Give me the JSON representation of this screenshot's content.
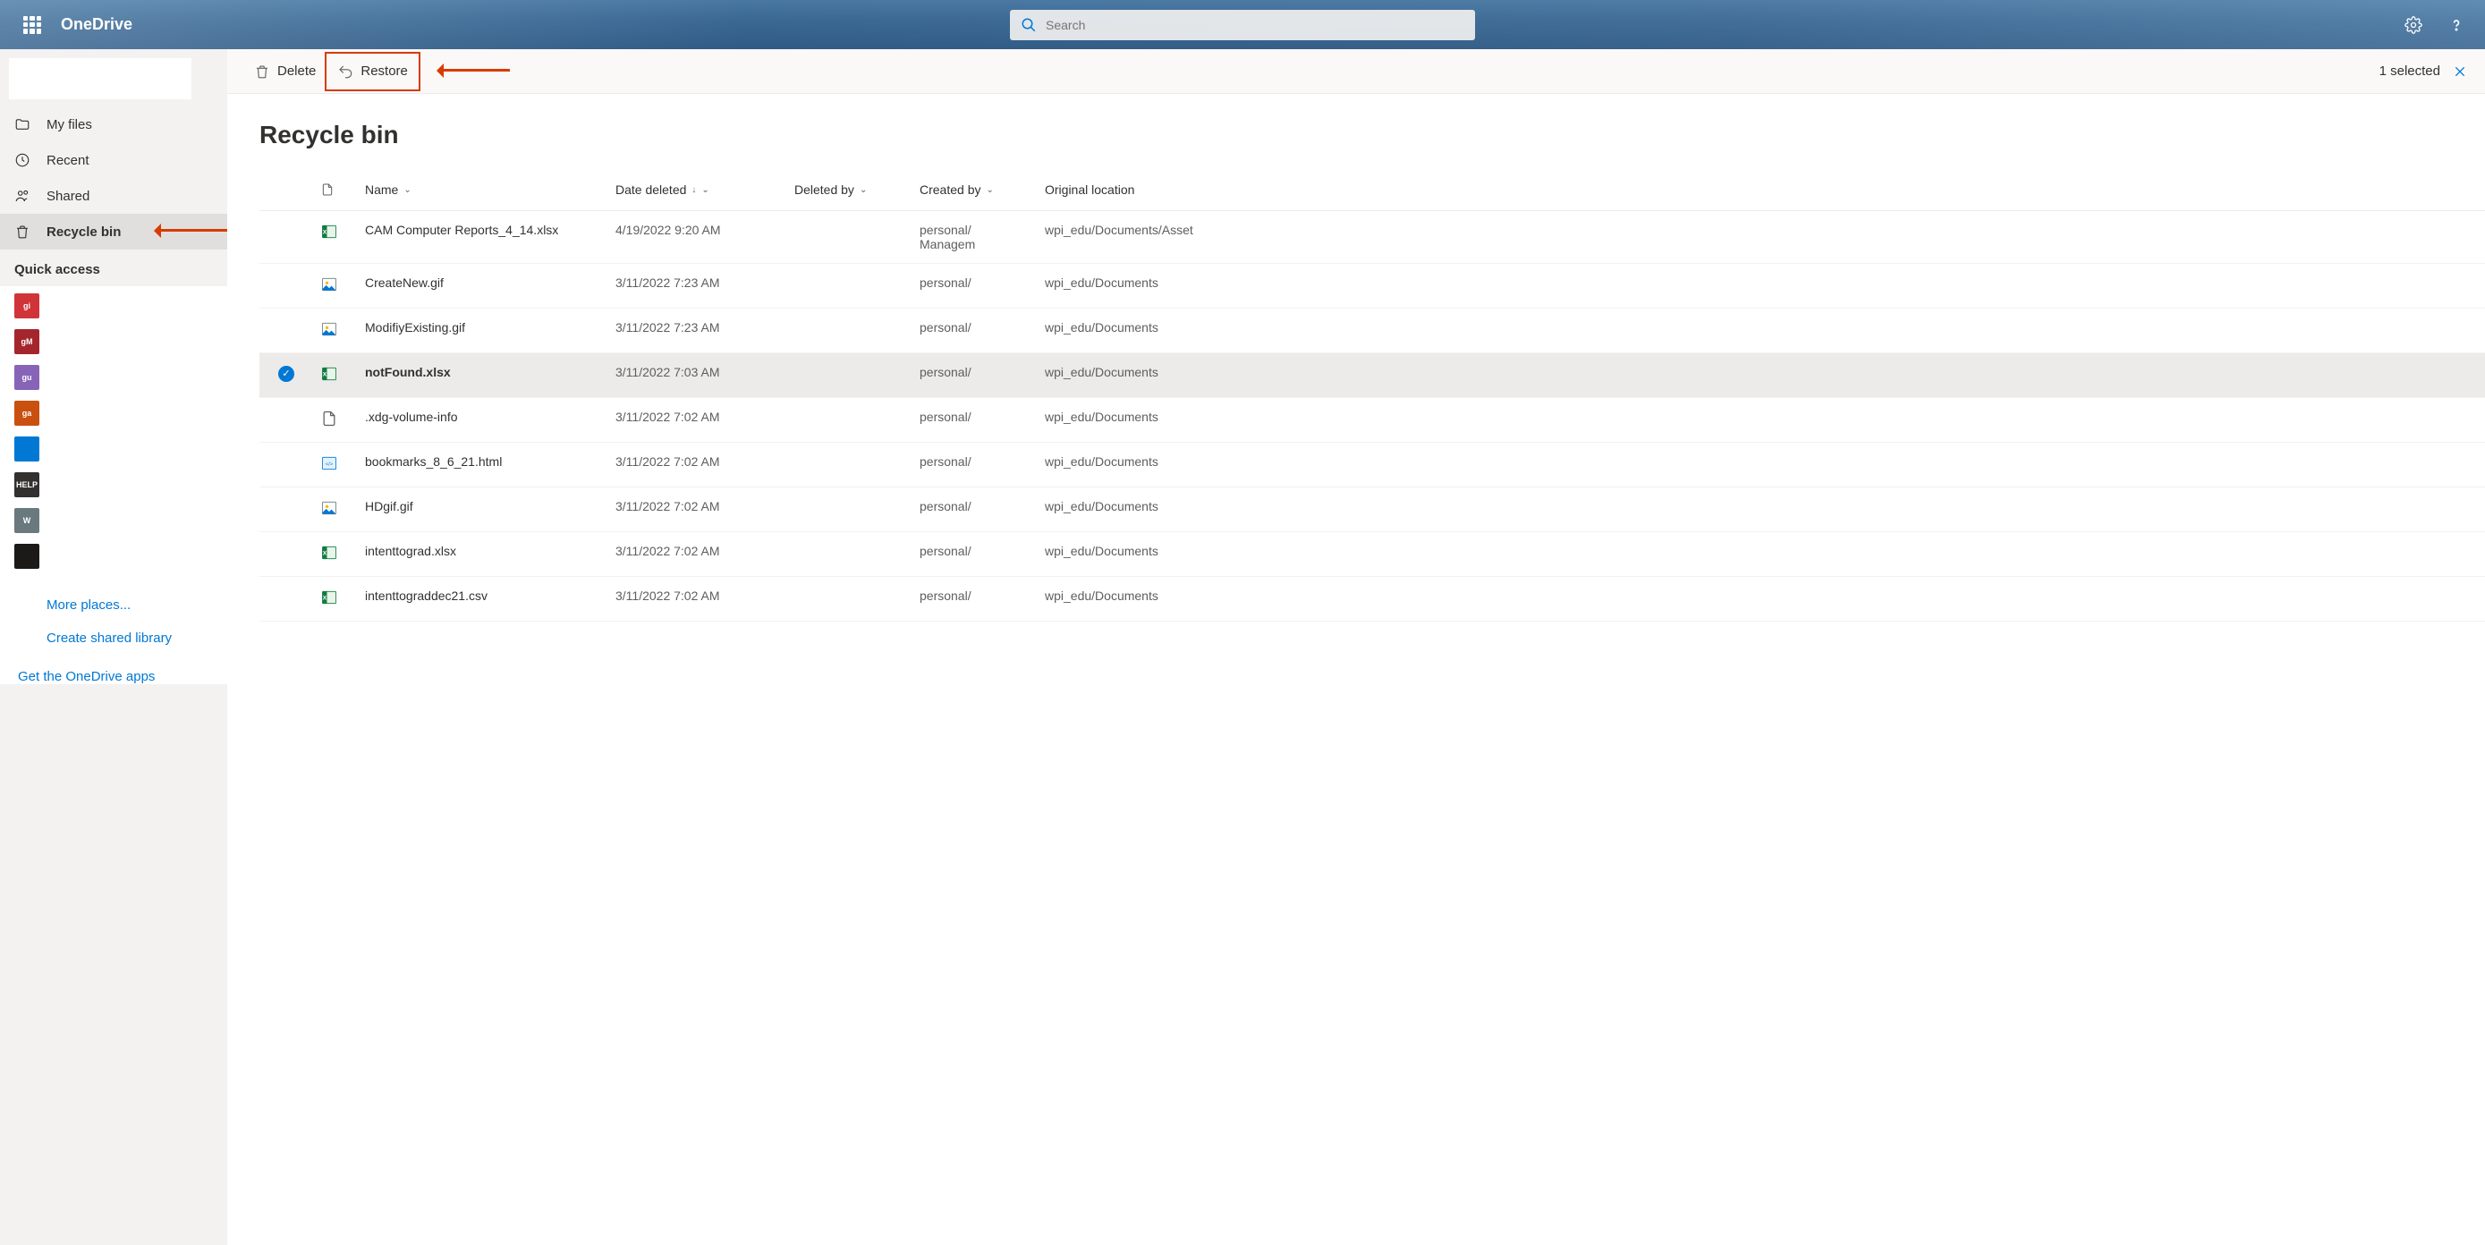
{
  "header": {
    "brand": "OneDrive",
    "search_placeholder": "Search"
  },
  "sidebar": {
    "items": [
      {
        "label": "My files"
      },
      {
        "label": "Recent"
      },
      {
        "label": "Shared"
      },
      {
        "label": "Recycle bin"
      }
    ],
    "quick_access_title": "Quick access",
    "tiles": [
      {
        "label": "gi",
        "bg": "#d13438"
      },
      {
        "label": "gM",
        "bg": "#a4262c"
      },
      {
        "label": "gu",
        "bg": "#8764b8"
      },
      {
        "label": "ga",
        "bg": "#ca5010"
      },
      {
        "label": "",
        "bg": "#0078d4"
      },
      {
        "label": "HELP",
        "bg": "#323130"
      },
      {
        "label": "W",
        "bg": "#69797e"
      },
      {
        "label": "",
        "bg": "#1b1a19"
      }
    ],
    "more_places": "More places...",
    "create_shared": "Create shared library",
    "get_apps": "Get the OneDrive apps"
  },
  "commandbar": {
    "delete": "Delete",
    "restore": "Restore",
    "selected": "1 selected"
  },
  "page": {
    "title": "Recycle bin",
    "columns": {
      "name": "Name",
      "date_deleted": "Date deleted",
      "deleted_by": "Deleted by",
      "created_by": "Created by",
      "original_location": "Original location"
    },
    "rows": [
      {
        "icon": "xlsx",
        "name": "CAM Computer Reports_4_14.xlsx",
        "date": "4/19/2022 9:20 AM",
        "delby": "",
        "crby_a": "personal/",
        "crby_b": "Managem",
        "loc": "wpi_edu/Documents/Asset",
        "selected": false
      },
      {
        "icon": "gif",
        "name": "CreateNew.gif",
        "date": "3/11/2022 7:23 AM",
        "delby": "",
        "crby_a": "personal/",
        "crby_b": "",
        "loc": "wpi_edu/Documents",
        "selected": false
      },
      {
        "icon": "gif",
        "name": "ModifiyExisting.gif",
        "date": "3/11/2022 7:23 AM",
        "delby": "",
        "crby_a": "personal/",
        "crby_b": "",
        "loc": "wpi_edu/Documents",
        "selected": false
      },
      {
        "icon": "xlsx",
        "name": "notFound.xlsx",
        "date": "3/11/2022 7:03 AM",
        "delby": "",
        "crby_a": "personal/",
        "crby_b": "",
        "loc": "wpi_edu/Documents",
        "selected": true
      },
      {
        "icon": "file",
        "name": ".xdg-volume-info",
        "date": "3/11/2022 7:02 AM",
        "delby": "",
        "crby_a": "personal/",
        "crby_b": "",
        "loc": "wpi_edu/Documents",
        "selected": false
      },
      {
        "icon": "html",
        "name": "bookmarks_8_6_21.html",
        "date": "3/11/2022 7:02 AM",
        "delby": "",
        "crby_a": "personal/",
        "crby_b": "",
        "loc": "wpi_edu/Documents",
        "selected": false
      },
      {
        "icon": "gif",
        "name": "HDgif.gif",
        "date": "3/11/2022 7:02 AM",
        "delby": "",
        "crby_a": "personal/",
        "crby_b": "",
        "loc": "wpi_edu/Documents",
        "selected": false
      },
      {
        "icon": "xlsx",
        "name": "intenttograd.xlsx",
        "date": "3/11/2022 7:02 AM",
        "delby": "",
        "crby_a": "personal/",
        "crby_b": "",
        "loc": "wpi_edu/Documents",
        "selected": false
      },
      {
        "icon": "csv",
        "name": "intenttograddec21.csv",
        "date": "3/11/2022 7:02 AM",
        "delby": "",
        "crby_a": "personal/",
        "crby_b": "",
        "loc": "wpi_edu/Documents",
        "selected": false
      }
    ]
  }
}
